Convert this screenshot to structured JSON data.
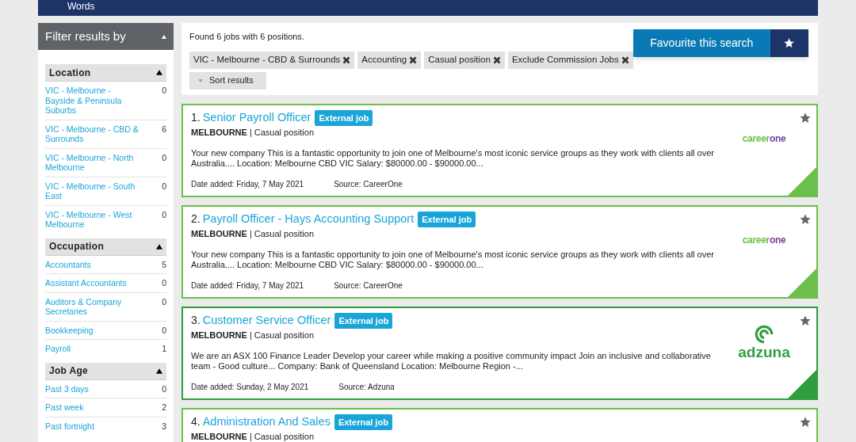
{
  "top_bar": {
    "text": "Words"
  },
  "filter": {
    "title": "Filter results by",
    "expanded": true,
    "groups": [
      {
        "title": "Location",
        "expanded": true,
        "items": [
          {
            "label": "VIC - Melbourne - Bayside & Peninsula Suburbs",
            "count": "0"
          },
          {
            "label": "VIC - Melbourne - CBD & Surrounds",
            "count": "6"
          },
          {
            "label": "VIC - Melbourne - North Melbourne",
            "count": "0"
          },
          {
            "label": "VIC - Melbourne - South East",
            "count": "0"
          },
          {
            "label": "VIC - Melbourne - West Melbourne",
            "count": "0"
          }
        ]
      },
      {
        "title": "Occupation",
        "expanded": true,
        "items": [
          {
            "label": "Accountants",
            "count": "5"
          },
          {
            "label": "Assistant Accountants",
            "count": "0"
          },
          {
            "label": "Auditors & Company Secretaries",
            "count": "0"
          },
          {
            "label": "Bookkeeping",
            "count": "0"
          },
          {
            "label": "Payroll",
            "count": "1"
          }
        ]
      },
      {
        "title": "Job Age",
        "expanded": true,
        "items": [
          {
            "label": "Past 3 days",
            "count": "0"
          },
          {
            "label": "Past week",
            "count": "2"
          },
          {
            "label": "Past fortnight",
            "count": "3"
          }
        ]
      }
    ]
  },
  "summary": "Found 6 jobs with 6 positions.",
  "favourite_button": "Favourite this search",
  "tags": [
    "VIC - Melbourne - CBD & Surrounds",
    "Accounting",
    "Casual position",
    "Exclude Commission Jobs"
  ],
  "sort_button": "Sort results",
  "jobs": [
    {
      "number": "1.",
      "title": "Senior Payroll Officer",
      "badge": "External job",
      "location": "MELBOURNE",
      "type": "| Casual position",
      "description": "Your new company This is a fantastic opportunity to join one of Melbourne's most iconic service groups as they work with clients all over Australia.... Location: Melbourne CBD VIC Salary: $80000.00 - $90000.00...",
      "date": "Date added: Friday, 7 May 2021",
      "source": "Source: CareerOne",
      "color": "#6cbf4a",
      "logo": {
        "kind": "careerone",
        "parts": [
          "career",
          "one"
        ]
      }
    },
    {
      "number": "2.",
      "title": "Payroll Officer - Hays Accounting Support",
      "badge": "External job",
      "location": "MELBOURNE",
      "type": "| Casual position",
      "description": "Your new company This is a fantastic opportunity to join one of Melbourne's most iconic service groups as they work with clients all over Australia.... Location: Melbourne CBD VIC Salary: $80000.00 - $90000.00...",
      "date": "Date added: Friday, 7 May 2021",
      "source": "Source: CareerOne",
      "color": "#6cbf4a",
      "logo": {
        "kind": "careerone",
        "parts": [
          "career",
          "one"
        ]
      }
    },
    {
      "number": "3.",
      "title": "Customer Service Officer",
      "badge": "External job",
      "location": "MELBOURNE",
      "type": "| Casual position",
      "description": "We are an ASX 100 Finance Leader Develop your career while making a positive community impact Join an inclusive and collaborative team - Good culture... Company: Bank of Queensland Location: Melbourne Region -...",
      "date": "Date added: Sunday, 2 May 2021",
      "source": "Source: Adzuna",
      "color": "#2e9e3e",
      "logo": {
        "kind": "adzuna",
        "text": "adzuna"
      }
    },
    {
      "number": "4.",
      "title": "Administration And Sales",
      "badge": "External job",
      "location": "MELBOURNE",
      "type": "| Casual position",
      "color": "#6cbf4a"
    }
  ]
}
